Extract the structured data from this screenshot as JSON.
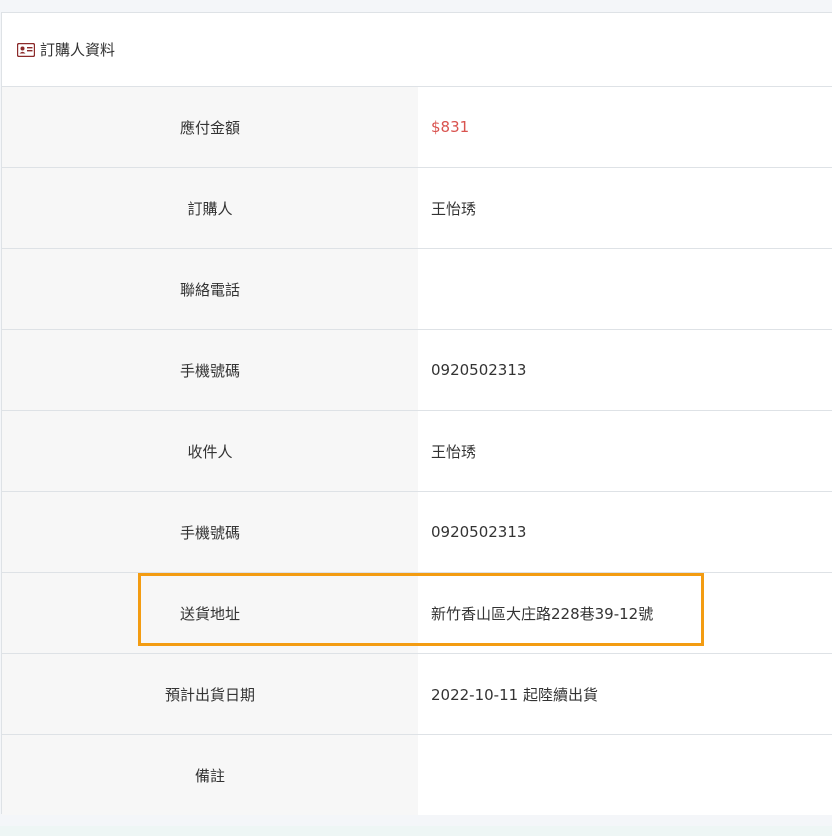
{
  "card": {
    "title": "訂購人資料",
    "icon": "id-card-icon"
  },
  "rows": [
    {
      "label": "應付金額",
      "value": "$831"
    },
    {
      "label": "訂購人",
      "value": "王怡琇"
    },
    {
      "label": "聯絡電話",
      "value": ""
    },
    {
      "label": "手機號碼",
      "value": "0920502313"
    },
    {
      "label": "收件人",
      "value": "王怡琇"
    },
    {
      "label": "手機號碼",
      "value": "0920502313"
    },
    {
      "label": "送貨地址",
      "value": "新竹香山區大庄路228巷39-12號"
    },
    {
      "label": "預計出貨日期",
      "value": "2022-10-11 起陸續出貨"
    },
    {
      "label": "備註",
      "value": ""
    }
  ],
  "colors": {
    "amount": "#d9534f",
    "highlight": "#f39c12",
    "icon": "#8b2a2a"
  }
}
